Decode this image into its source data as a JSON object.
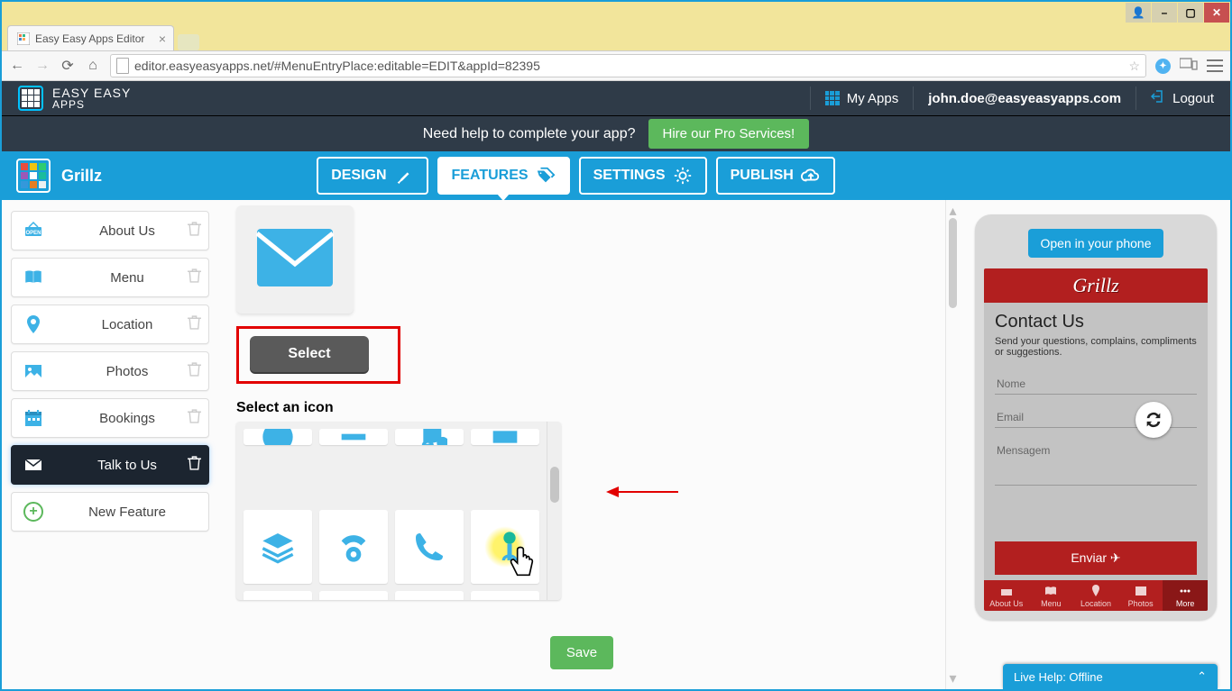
{
  "window": {
    "tab_title": "Easy Easy Apps Editor"
  },
  "url": "editor.easyeasyapps.net/#MenuEntryPlace:editable=EDIT&appId=82395",
  "header": {
    "brand_top": "EASY EASY",
    "brand_bottom": "APPS",
    "my_apps": "My Apps",
    "user_email": "john.doe@easyeasyapps.com",
    "logout": "Logout"
  },
  "promo": {
    "text": "Need help to complete your app?",
    "button": "Hire our Pro Services!"
  },
  "app_name": "Grillz",
  "nav": {
    "design": "DESIGN",
    "features": "FEATURES",
    "settings": "SETTINGS",
    "publish": "PUBLISH"
  },
  "features": [
    {
      "label": "About Us"
    },
    {
      "label": "Menu"
    },
    {
      "label": "Location"
    },
    {
      "label": "Photos"
    },
    {
      "label": "Bookings"
    },
    {
      "label": "Talk to Us"
    }
  ],
  "new_feature": "New Feature",
  "select_button": "Select",
  "section_title": "Select an icon",
  "save": "Save",
  "preview": {
    "open_phone": "Open in your phone",
    "app_title": "Grillz",
    "page_title": "Contact Us",
    "page_sub": "Send your questions, complains, compliments or suggestions.",
    "field_name": "Nome",
    "field_email": "Email",
    "field_msg": "Mensagem",
    "send": "Enviar",
    "nav": [
      "About Us",
      "Menu",
      "Location",
      "Photos",
      "More"
    ]
  },
  "live_help": "Live Help: Offline"
}
